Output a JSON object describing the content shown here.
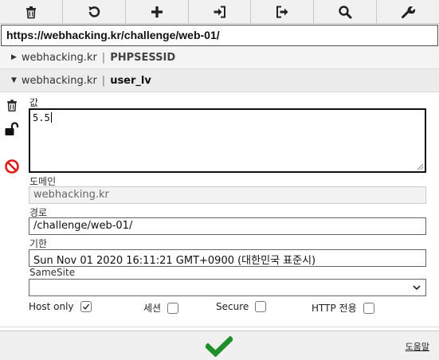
{
  "toolbar": {
    "buttons": [
      {
        "icon": "trash-icon"
      },
      {
        "icon": "reset-icon"
      },
      {
        "icon": "add-icon"
      },
      {
        "icon": "import-icon"
      },
      {
        "icon": "export-icon"
      },
      {
        "icon": "search-icon"
      },
      {
        "icon": "wrench-icon"
      }
    ]
  },
  "url": "https://webhacking.kr/challenge/web-01/",
  "cookies": [
    {
      "domain": "webhacking.kr",
      "separator": "|",
      "name": "PHPSESSID",
      "expanded": false
    },
    {
      "domain": "webhacking.kr",
      "separator": "|",
      "name": "user_lv",
      "expanded": true
    }
  ],
  "editor": {
    "value_label": "값",
    "value": "5.5",
    "domain_label": "도메인",
    "domain_value": "webhacking.kr",
    "path_label": "경로",
    "path_value": "/challenge/web-01/",
    "expires_label": "기한",
    "expires_value": "Sun Nov 01 2020 16:11:21 GMT+0900 (대한민국 표준시)",
    "samesite_label": "SameSite",
    "samesite_value": "",
    "options": {
      "host_only": {
        "label": "Host only",
        "checked": true
      },
      "session": {
        "label": "세션",
        "checked": false
      },
      "secure": {
        "label": "Secure",
        "checked": false
      },
      "http_only": {
        "label": "HTTP 전용",
        "checked": false
      }
    }
  },
  "footer": {
    "help_label": "도움말"
  },
  "colors": {
    "confirm_green": "#1e8f2a",
    "block_red": "#e01b1b"
  }
}
